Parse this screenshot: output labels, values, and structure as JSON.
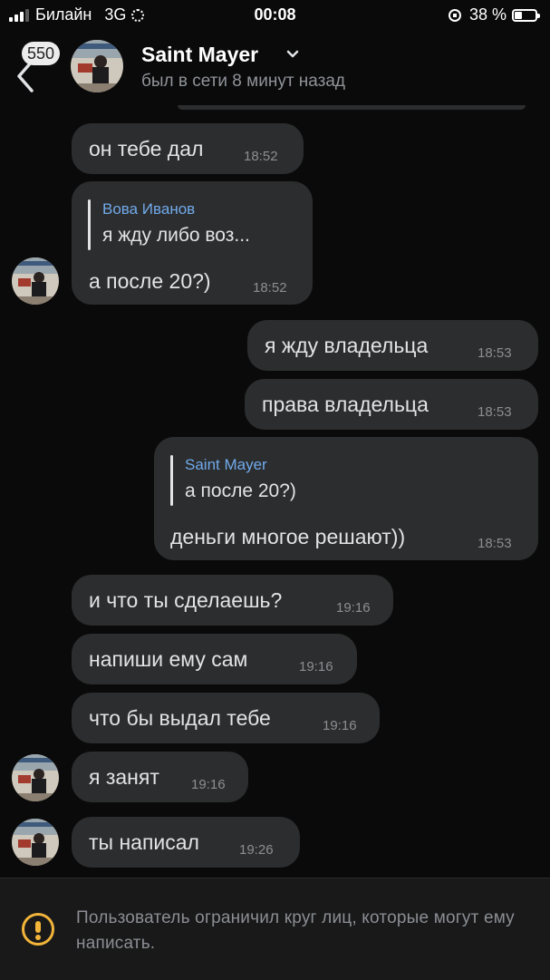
{
  "status_bar": {
    "carrier": "Билайн",
    "network": "3G",
    "time": "00:08",
    "battery": "38 %"
  },
  "header": {
    "unread_badge": "550",
    "name": "Saint Mayer",
    "status": "был в сети 8 минут назад"
  },
  "messages": [
    {
      "text": "он тебе дал",
      "time": "18:52"
    },
    {
      "reply_name": "Вова Иванов",
      "reply_text": "я жду либо воз...",
      "text": "а после 20?)",
      "time": "18:52"
    },
    {
      "text": "я жду владельца",
      "time": "18:53"
    },
    {
      "text": "права владельца",
      "time": "18:53"
    },
    {
      "reply_name": "Saint Mayer",
      "reply_text": "а после 20?)",
      "text": "деньги многое решают))",
      "time": "18:53"
    },
    {
      "text": "и что ты сделаешь?",
      "time": "19:16"
    },
    {
      "text": "напиши ему сам",
      "time": "19:16"
    },
    {
      "text": "что бы выдал тебе",
      "time": "19:16"
    },
    {
      "text": "я занят",
      "time": "19:16"
    },
    {
      "text": "ты написал",
      "time": "19:26"
    }
  ],
  "footer": {
    "notice": "Пользователь ограничил круг лиц, которые могут ему написать."
  },
  "colors": {
    "background": "#0a0a0a",
    "bubble": "#2c2d2e",
    "reply_name": "#71aaeb",
    "warning": "#f2b53a"
  }
}
